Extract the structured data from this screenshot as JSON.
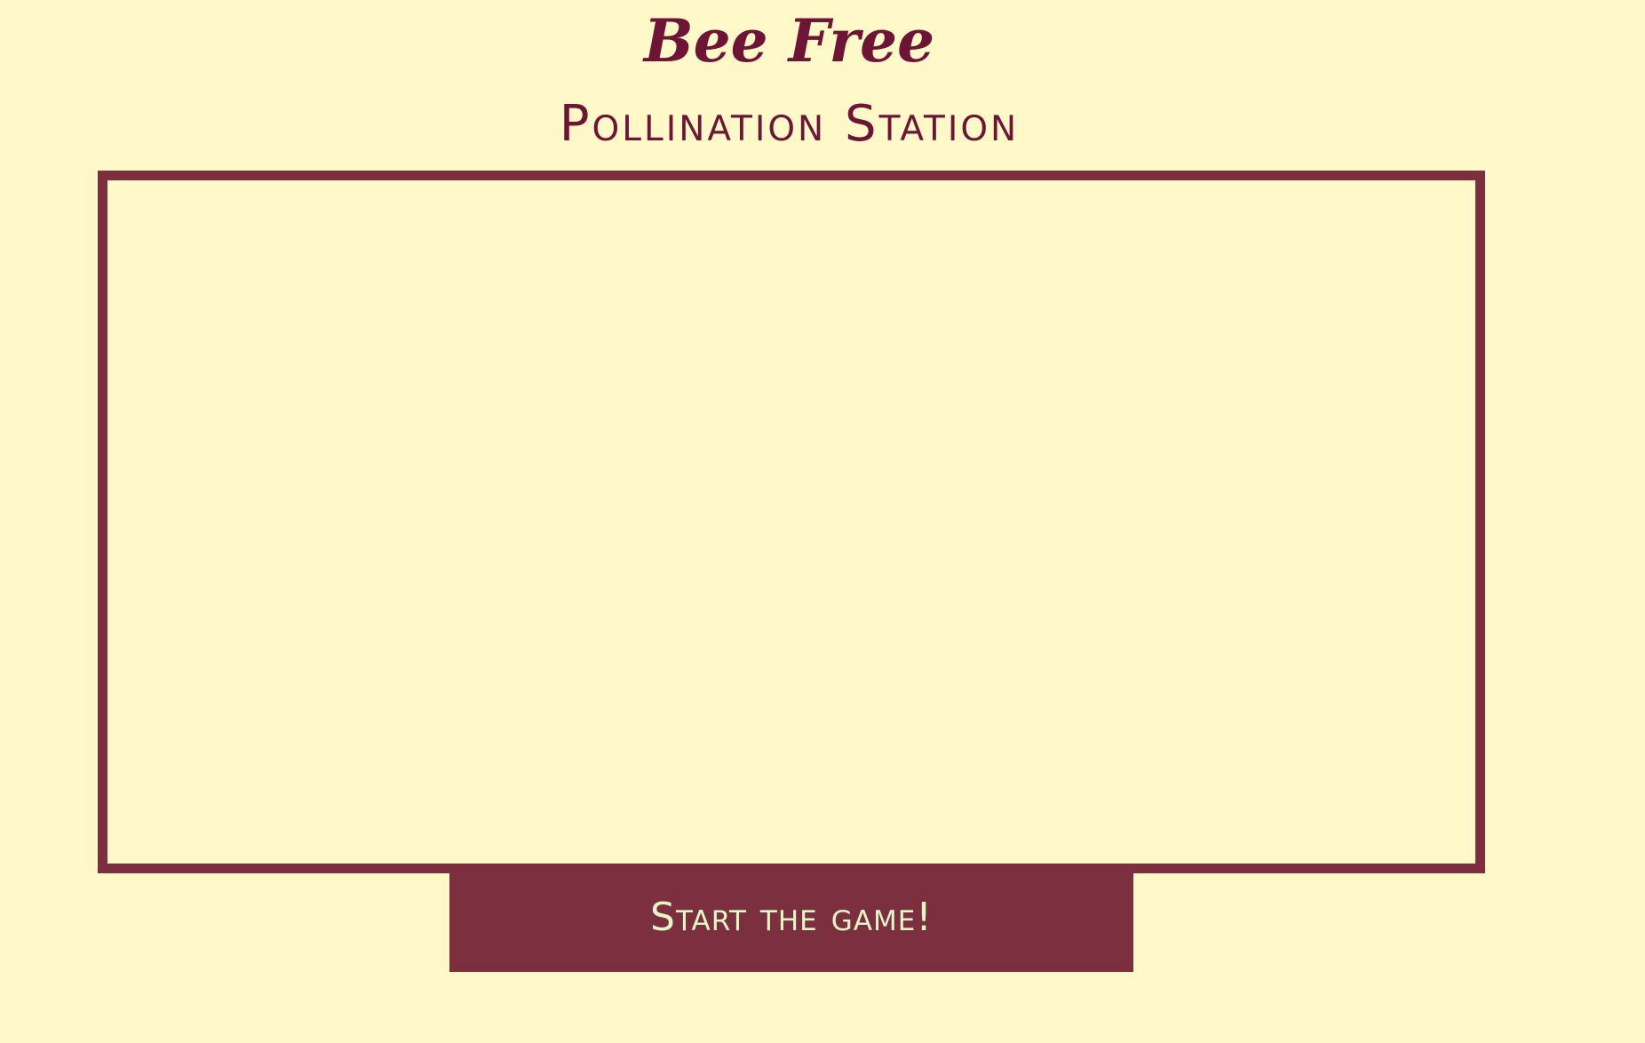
{
  "header": {
    "title": "Bee Free",
    "subtitle": "Pollination Station"
  },
  "game": {
    "start_button_label": "Start the game!"
  },
  "colors": {
    "background": "#fff8c9",
    "accent": "#7b2f3f",
    "title_text": "#6e1434",
    "button_text": "#e4f5c6"
  }
}
